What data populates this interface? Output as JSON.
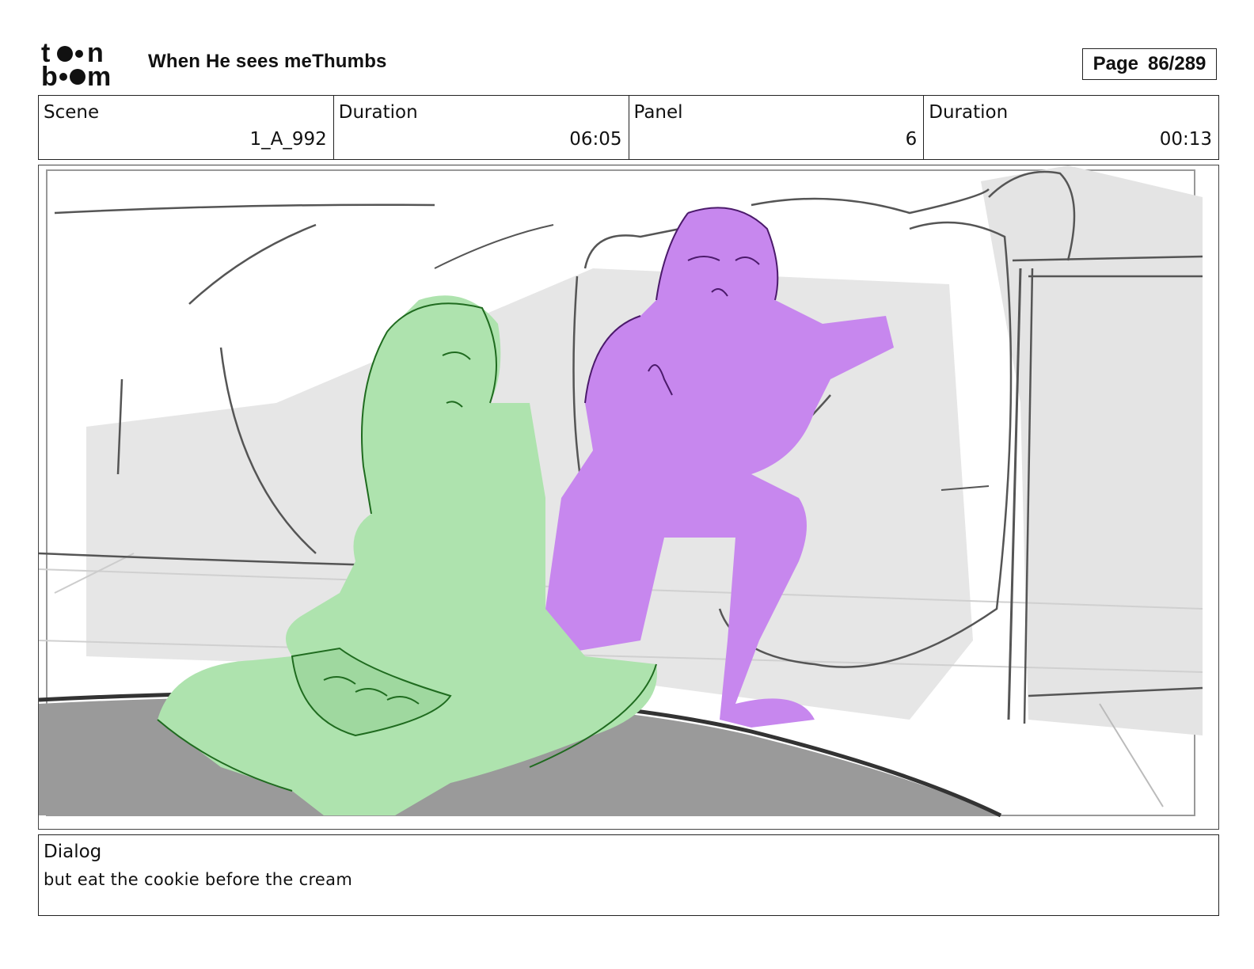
{
  "header": {
    "brand": "toon boom",
    "project_title": "When He sees meThumbs",
    "page_label": "Page",
    "page_number": "86/289"
  },
  "info": {
    "scene_label": "Scene",
    "scene_value": "1_A_992",
    "scene_duration_label": "Duration",
    "scene_duration_value": "06:05",
    "panel_label": "Panel",
    "panel_value": "6",
    "panel_duration_label": "Duration",
    "panel_duration_value": "00:13"
  },
  "panel_image": {
    "description_colors": {
      "green_figure": "#aee3ae",
      "purple_figure": "#c787ee",
      "rug": "#9a9a9a",
      "shadow": "#e6e6e6"
    }
  },
  "dialog": {
    "label": "Dialog",
    "text": "but eat the cookie before the cream"
  }
}
